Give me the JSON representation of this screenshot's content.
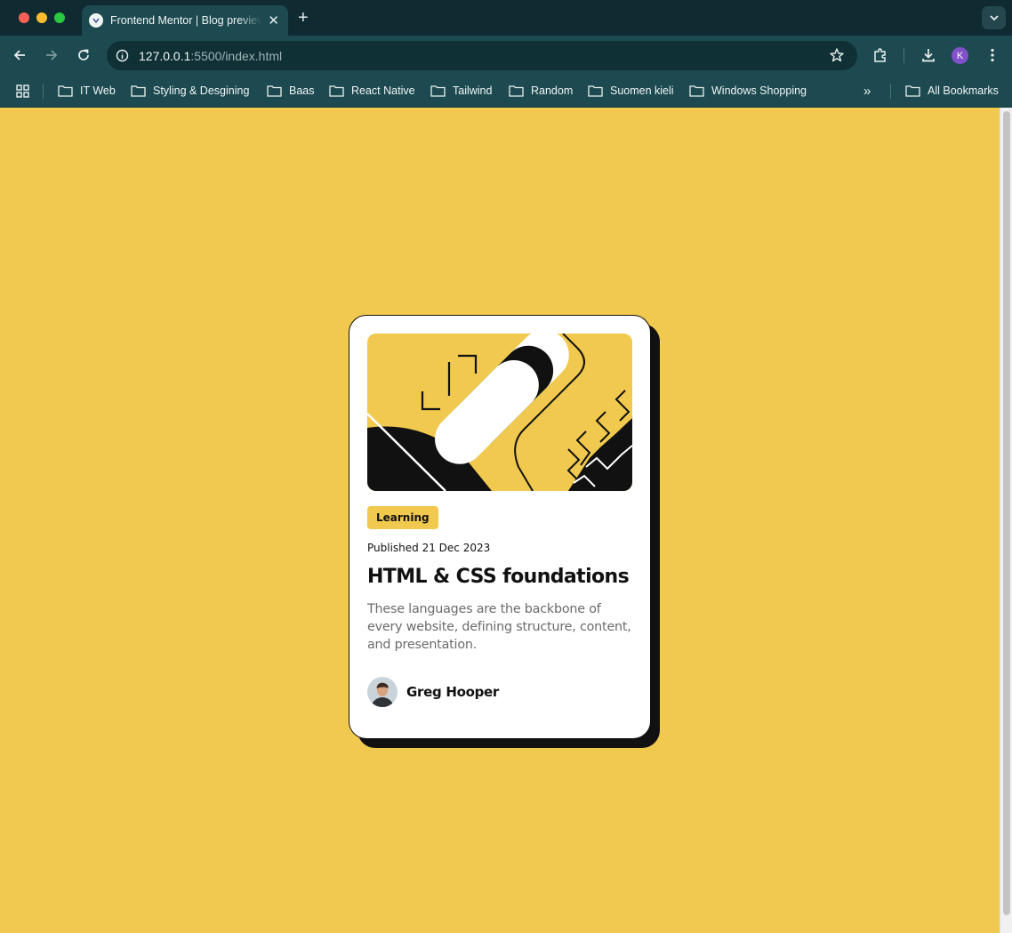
{
  "browser": {
    "tab": {
      "title": "Frontend Mentor | Blog preview card",
      "close_glyph": "✕"
    },
    "new_tab_glyph": "+",
    "address": {
      "host": "127.0.0.1",
      "rest": ":5500/index.html"
    },
    "profile_initial": "K",
    "bookmarks": [
      "IT Web",
      "Styling & Desgining",
      "Baas",
      "React Native",
      "Tailwind",
      "Random",
      "Suomen kieli",
      "Windows Shopping"
    ],
    "bookmarks_overflow": "»",
    "all_bookmarks": "All Bookmarks"
  },
  "card": {
    "tag": "Learning",
    "published": "Published 21 Dec 2023",
    "title": "HTML & CSS foundations",
    "excerpt": "These languages are the backbone of every website, defining structure, content, and presentation.",
    "author": "Greg Hooper"
  },
  "colors": {
    "page_background": "#F1C94F",
    "card_background": "#FFFFFF",
    "ink": "#111111",
    "muted_text": "#6B6B6B",
    "chrome_toolbar": "#1D4A50",
    "chrome_tabstrip": "#0F2A30"
  }
}
